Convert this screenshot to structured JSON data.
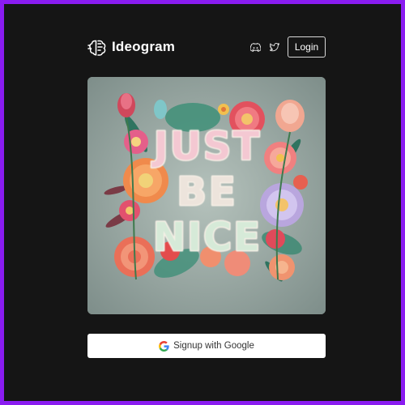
{
  "header": {
    "brand_name": "Ideogram",
    "brand_icon": "brain-icon",
    "social": [
      {
        "icon": "discord-icon"
      },
      {
        "icon": "twitter-icon"
      }
    ],
    "login_label": "Login"
  },
  "artwork": {
    "text_lines": [
      "JUST",
      "BE",
      "NICE"
    ]
  },
  "signup": {
    "label": "Signup with Google",
    "icon": "google-icon"
  },
  "colors": {
    "frame_border": "#8a1cf0",
    "background": "#151515",
    "button_bg": "#ffffff"
  }
}
